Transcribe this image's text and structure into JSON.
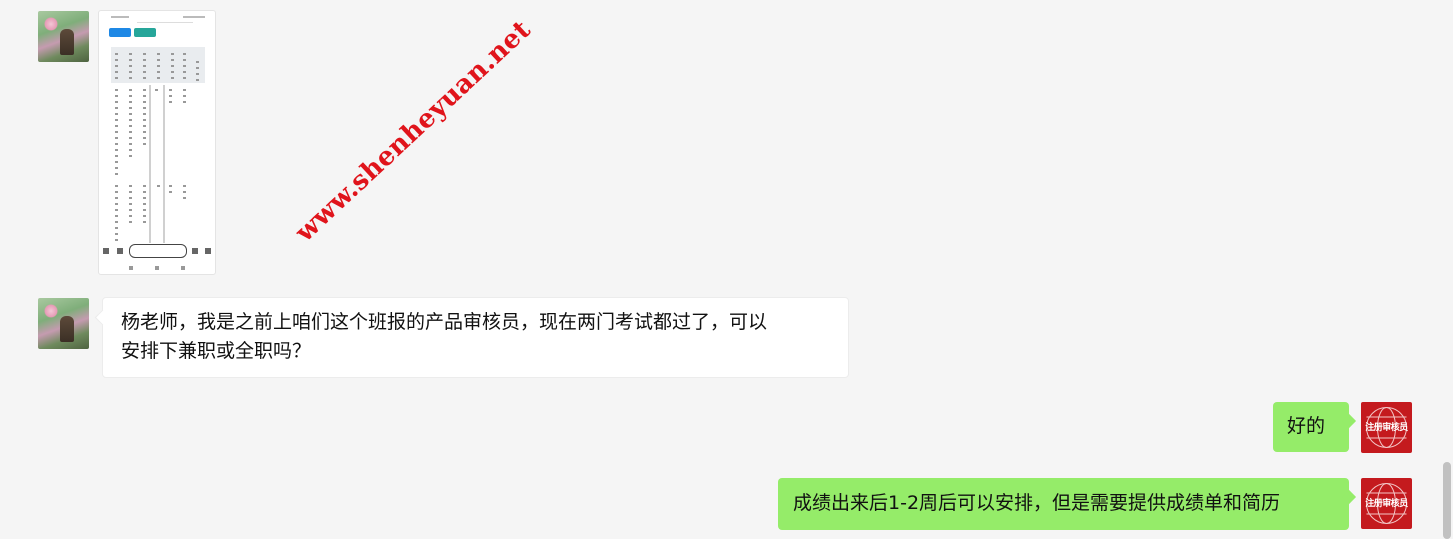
{
  "messages": [
    {
      "id": "img",
      "from": "user",
      "type": "image"
    },
    {
      "id": "m1",
      "from": "user",
      "type": "text",
      "lines": [
        "杨老师，我是之前上咱们这个班报的产品审核员，现在两门考试都过了，可以",
        "安排下兼职或全职吗？"
      ]
    },
    {
      "id": "m2",
      "from": "self",
      "type": "text",
      "text": "好的"
    },
    {
      "id": "m3",
      "from": "self",
      "type": "text",
      "text": "成绩出来后1-2周后可以安排，但是需要提供成绩单和简历"
    }
  ],
  "brand_avatar_text": "注册审核员",
  "watermark": "www.shenheyuan.net",
  "colors": {
    "outgoing_bubble": "#95ec69",
    "incoming_bubble": "#ffffff",
    "background": "#f5f5f5",
    "brand": "#c41a1e",
    "watermark": "#e0141b"
  }
}
